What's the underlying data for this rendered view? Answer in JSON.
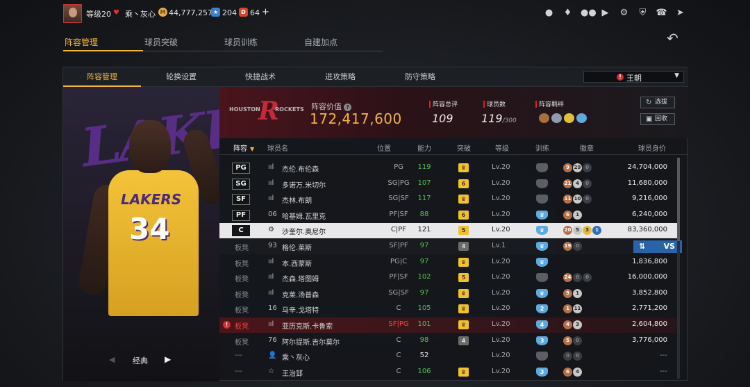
{
  "topbar": {
    "level": "等级20",
    "team_name": "乘丶灰心",
    "coins": "44,777,257",
    "stars": "204",
    "points": "64",
    "plus": "+"
  },
  "main_tabs": [
    "阵容管理",
    "球员突破",
    "球员训练",
    "自建加点"
  ],
  "sub_tabs": [
    "阵容管理",
    "轮换设置",
    "快捷战术",
    "进攻策略",
    "防守策略"
  ],
  "team_select": {
    "warn": "!",
    "value": "王朝"
  },
  "portrait": {
    "bg_word": "LAKERS",
    "jersey_text": "LAKERS",
    "jersey_number": "34",
    "nav_label": "经典"
  },
  "summary": {
    "logo_left": "HOUSTON",
    "logo_right": "ROCKETS",
    "value_label": "阵容价值",
    "value": "172,417,600",
    "total_label": "阵容总评",
    "total_value": "109",
    "count_label": "球员数",
    "count_value": "119",
    "count_max": "/300",
    "bond_label": "阵容羁绊",
    "select_btn": "选拔",
    "recycle_btn": "回收"
  },
  "table_headers": {
    "lineup": "阵容",
    "name": "球员名",
    "position": "位置",
    "rating": "能力",
    "breakthrough": "突破",
    "level": "等级",
    "training": "训练",
    "badges": "徽章",
    "value": "球员身价"
  },
  "rows": [
    {
      "slot": "PG",
      "pic": "ııl",
      "name": "杰伦.布伦森",
      "pos": "PG",
      "rating": "119",
      "brk": "♛",
      "lv": "Lv.20",
      "train": "",
      "badges": [
        {
          "t": "9",
          "c": "bronze"
        },
        {
          "t": "29",
          "c": "silver"
        },
        {
          "t": "0",
          "c": "empty"
        }
      ],
      "value": "24,704,000"
    },
    {
      "slot": "SG",
      "pic": "ııl",
      "name": "多诺万.米切尔",
      "pos": "SG|PG",
      "rating": "107",
      "brk": "6",
      "lv": "Lv.20",
      "train": "",
      "badges": [
        {
          "t": "21",
          "c": "bronze"
        },
        {
          "t": "4",
          "c": "silver"
        },
        {
          "t": "0",
          "c": "empty"
        }
      ],
      "value": "11,680,000"
    },
    {
      "slot": "SF",
      "pic": "ııl",
      "name": "杰林.布朗",
      "pos": "SG|SF",
      "rating": "117",
      "brk": "♛",
      "lv": "Lv.20",
      "train": "",
      "badges": [
        {
          "t": "11",
          "c": "bronze"
        },
        {
          "t": "10",
          "c": "silver"
        },
        {
          "t": "0",
          "c": "empty"
        }
      ],
      "value": "9,216,000"
    },
    {
      "slot": "PF",
      "pic": "06",
      "name": "哈基姆.瓦里克",
      "pos": "PF|SF",
      "rating": "88",
      "brk": "6",
      "lv": "Lv.20",
      "train": "♛",
      "badges": [
        {
          "t": "6",
          "c": "bronze"
        },
        {
          "t": "1",
          "c": "silver"
        }
      ],
      "value": "6,240,000"
    },
    {
      "slot": "C",
      "pic": "⚙",
      "name": "沙奎尔.奥尼尔",
      "pos": "C|PF",
      "rating": "121",
      "brk": "5",
      "lv": "Lv.20",
      "train": "♛",
      "badges": [
        {
          "t": "20",
          "c": "bronze"
        },
        {
          "t": "5",
          "c": "silver"
        },
        {
          "t": "3",
          "c": "gold"
        },
        {
          "t": "1",
          "c": "blue"
        }
      ],
      "value": "83,360,000"
    },
    {
      "slot": "板凳",
      "pic": "93",
      "name": "格伦.莱斯",
      "pos": "SF|PF",
      "rating": "97",
      "brk": "4",
      "lv": "Lv.1",
      "train": "♛",
      "badges": [
        {
          "t": "19",
          "c": "bronze"
        },
        {
          "t": "0",
          "c": "empty"
        }
      ],
      "value": ""
    },
    {
      "slot": "板凳",
      "pic": "ııl",
      "name": "本.西蒙斯",
      "pos": "PG|C",
      "rating": "97",
      "brk": "♛",
      "lv": "Lv.20",
      "train": "♛",
      "badges": [],
      "value": "1,836,800"
    },
    {
      "slot": "板凳",
      "pic": "ııl",
      "name": "杰森.塔图姆",
      "pos": "PF|SF",
      "rating": "102",
      "brk": "5",
      "lv": "Lv.20",
      "train": "",
      "badges": [
        {
          "t": "24",
          "c": "bronze"
        },
        {
          "t": "0",
          "c": "empty"
        },
        {
          "t": "0",
          "c": "empty"
        }
      ],
      "value": "16,000,000"
    },
    {
      "slot": "板凳",
      "pic": "ııl",
      "name": "克莱.汤普森",
      "pos": "SG|SF",
      "rating": "97",
      "brk": "♛",
      "lv": "Lv.20",
      "train": "♛",
      "badges": [
        {
          "t": "9",
          "c": "bronze"
        },
        {
          "t": "1",
          "c": "silver"
        }
      ],
      "value": "3,852,800"
    },
    {
      "slot": "板凳",
      "pic": "16",
      "name": "马辛.戈塔特",
      "pos": "C",
      "rating": "105",
      "brk": "♛",
      "lv": "Lv.20",
      "train": "2",
      "badges": [
        {
          "t": "1",
          "c": "bronze"
        },
        {
          "t": "11",
          "c": "silver"
        }
      ],
      "value": "2,771,200"
    },
    {
      "slot": "板凳",
      "pic": "ııl",
      "name": "亚历克斯.卡鲁索",
      "pos": "SF|PG",
      "rating": "101",
      "brk": "♛",
      "lv": "Lv.20",
      "train": "4",
      "badges": [
        {
          "t": "4",
          "c": "bronze"
        },
        {
          "t": "3",
          "c": "silver"
        }
      ],
      "value": "2,604,800",
      "warn": true
    },
    {
      "slot": "板凳",
      "pic": "76",
      "name": "阿尔提斯.吉尔莫尔",
      "pos": "C",
      "rating": "98",
      "brk": "4",
      "lv": "Lv.20",
      "train": "3",
      "badges": [
        {
          "t": "5",
          "c": "bronze"
        },
        {
          "t": "0",
          "c": "empty"
        }
      ],
      "value": "3,776,000"
    },
    {
      "slot": "---",
      "pic": "👤",
      "name": "乘丶灰心",
      "pos": "C",
      "rating": "52",
      "brk": "",
      "lv": "Lv.20",
      "train": "",
      "badges": [
        {
          "t": "0",
          "c": "empty"
        },
        {
          "t": "0",
          "c": "empty"
        }
      ],
      "value": "---"
    },
    {
      "slot": "---",
      "pic": "☆",
      "name": "王治郅",
      "pos": "C",
      "rating": "106",
      "brk": "♛",
      "lv": "Lv.20",
      "train": "3",
      "badges": [
        {
          "t": "6",
          "c": "bronze"
        },
        {
          "t": "4",
          "c": "silver"
        }
      ],
      "value": "---"
    }
  ],
  "vs_button": {
    "swap": "⇅",
    "label": "VS"
  },
  "colors": {
    "accent": "#f2b43c",
    "selected_row": "#e8e8ea",
    "rating_green": "#4fc24f",
    "warn_red": "#d62b2b"
  }
}
